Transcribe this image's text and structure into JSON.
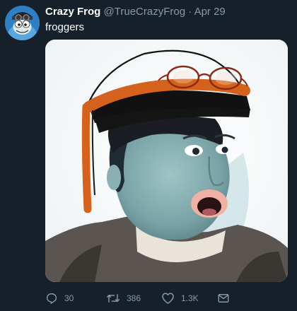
{
  "tweet": {
    "display_name": "Crazy Frog",
    "handle": "@TrueCrazyFrog",
    "separator": "·",
    "date": "Apr 29",
    "text": "froggers",
    "avatar_icon": "crazy-frog-avatar",
    "media_icon": "pogchamp-frog-helmet-drawing"
  },
  "actions": {
    "reply_count": "30",
    "retweet_count": "386",
    "like_count": "1.3K",
    "reply_icon": "reply-icon",
    "retweet_icon": "retweet-icon",
    "like_icon": "heart-icon",
    "dm_icon": "envelope-icon"
  },
  "colors": {
    "background": "#15202b",
    "text_primary": "#ffffff",
    "text_secondary": "#8899a6",
    "helmet_orange": "#d4621c"
  }
}
